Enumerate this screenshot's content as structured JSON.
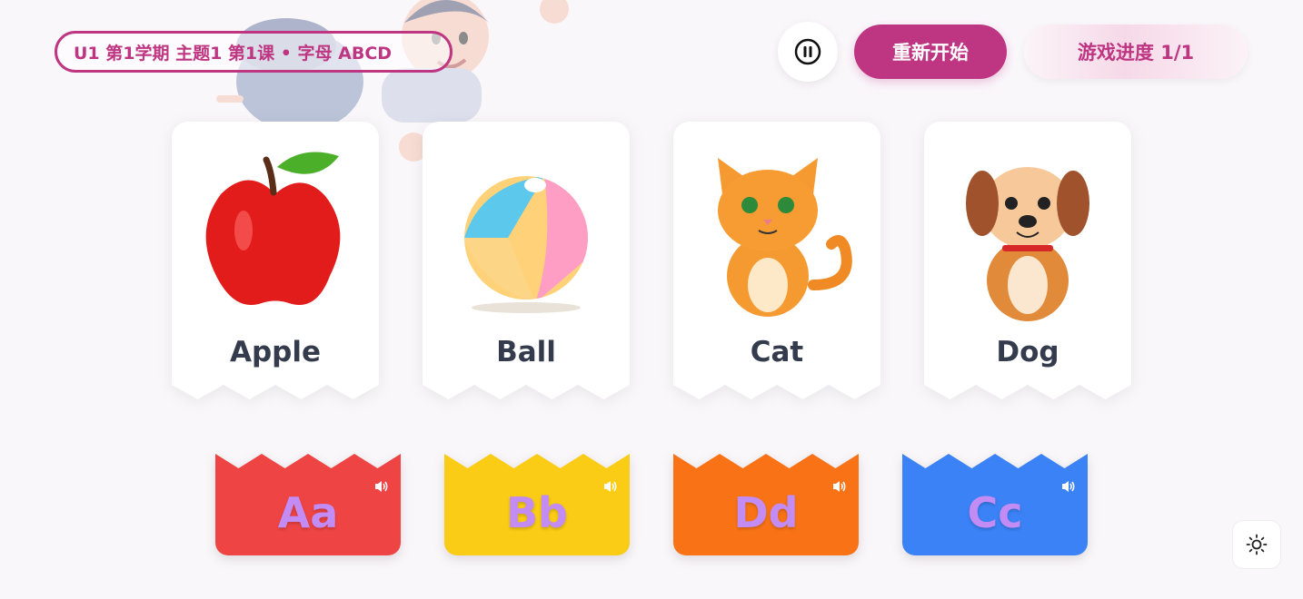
{
  "header": {
    "lesson_title": "U1 第1学期 主题1 第1课 • 字母 ABCD",
    "restart_label": "重新开始",
    "progress_label": "游戏进度 1/1",
    "pause_icon": "pause-icon",
    "accent_color": "#be3582"
  },
  "cards": [
    {
      "word": "Apple",
      "icon": "apple-icon"
    },
    {
      "word": "Ball",
      "icon": "ball-icon"
    },
    {
      "word": "Cat",
      "icon": "cat-icon"
    },
    {
      "word": "Dog",
      "icon": "dog-icon"
    }
  ],
  "tiles": [
    {
      "letter": "Aa",
      "color": "#ef4444"
    },
    {
      "letter": "Bb",
      "color": "#facc15"
    },
    {
      "letter": "Dd",
      "color": "#f97316"
    },
    {
      "letter": "Cc",
      "color": "#3b82f6"
    }
  ],
  "footer": {
    "theme_icon": "sun-icon"
  }
}
